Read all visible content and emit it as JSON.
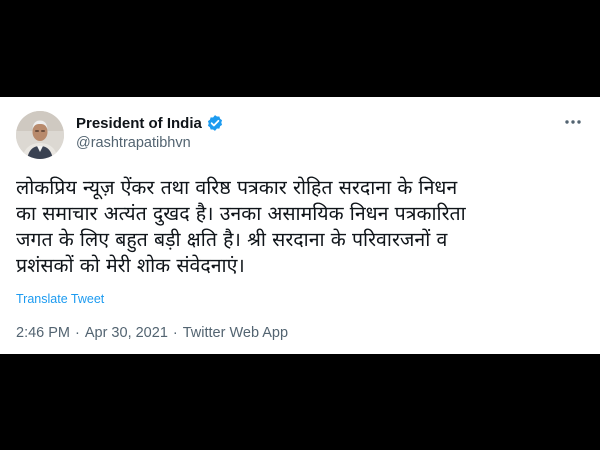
{
  "author": {
    "display_name": "President of India",
    "handle": "@rashtrapatibhvn",
    "verified": true,
    "avatar_icon": "profile-photo"
  },
  "tweet": {
    "text": "लोकप्रिय न्यूज़ ऐंकर तथा वरिष्ठ पत्रकार रोहित सरदाना के निधन\nका समाचार अत्यंत दुखद है। उनका असामयिक निधन पत्रकारिता\nजगत के लिए बहुत बड़ी क्षति है। श्री सरदाना के परिवारजनों व\nप्रशंसकों को मेरी शोक संवेदनाएं।",
    "translate_label": "Translate Tweet",
    "time": "2:46 PM",
    "separator": "·",
    "date": "Apr 30, 2021",
    "source": "Twitter Web App"
  },
  "icons": {
    "more": "more-horizontal-icon",
    "verified": "verified-badge-icon"
  },
  "colors": {
    "page_background": "#000000",
    "card_background": "#ffffff",
    "text_primary": "#0f1419",
    "text_secondary": "#536471",
    "accent": "#1d9bf0"
  }
}
